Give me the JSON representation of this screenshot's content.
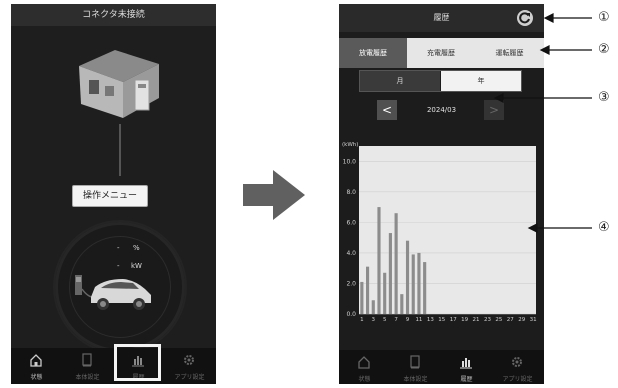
{
  "left_phone": {
    "header_title": "コネクタ未接続",
    "menu_button": "操作メニュー",
    "percent_value": "-",
    "percent_unit": "%",
    "power_value": "-",
    "power_unit": "kW",
    "nav": [
      {
        "label": "状態",
        "icon": "home-icon",
        "active": true
      },
      {
        "label": "本体設定",
        "icon": "device-icon",
        "active": false
      },
      {
        "label": "履歴",
        "icon": "bar-chart-icon",
        "active": false
      },
      {
        "label": "アプリ設定",
        "icon": "gear-icon",
        "active": false
      }
    ]
  },
  "right_phone": {
    "header_title": "履歴",
    "tabs": [
      "放電履歴",
      "充電履歴",
      "運転履歴"
    ],
    "active_tab": 0,
    "period_toggle": {
      "month": "月",
      "year": "年"
    },
    "date": "2024/03",
    "prev_glyph": "<",
    "next_glyph": ">",
    "nav": [
      {
        "label": "状態",
        "icon": "home-icon"
      },
      {
        "label": "本体設定",
        "icon": "device-icon"
      },
      {
        "label": "履歴",
        "icon": "bar-chart-icon",
        "active": true
      },
      {
        "label": "アプリ設定",
        "icon": "gear-icon"
      }
    ]
  },
  "callouts": [
    "①",
    "②",
    "③",
    "④"
  ],
  "colors": {
    "bar": "#8c8c8c",
    "plot_bg": "#e8e8e8",
    "dark": "#1c1c1c"
  },
  "chart_data": {
    "type": "bar",
    "ylabel": "(kWh)",
    "ylim": [
      0,
      11
    ],
    "yticks": [
      "0.0",
      "2.0",
      "4.0",
      "6.0",
      "8.0",
      "10.0"
    ],
    "x": [
      1,
      2,
      3,
      4,
      5,
      6,
      7,
      8,
      9,
      10,
      11,
      12,
      13,
      14,
      15,
      16,
      17,
      18,
      19,
      20,
      21,
      22,
      23,
      24,
      25,
      26,
      27,
      28,
      29,
      30,
      31
    ],
    "xtick_labels": [
      "1",
      "3",
      "5",
      "7",
      "9",
      "11",
      "13",
      "15",
      "17",
      "19",
      "21",
      "23",
      "25",
      "27",
      "29",
      "31"
    ],
    "values": [
      2.1,
      3.1,
      0.9,
      7.0,
      2.7,
      5.3,
      6.6,
      1.3,
      4.8,
      3.9,
      4.0,
      3.4,
      0,
      0,
      0,
      0,
      0,
      0,
      0,
      0,
      0,
      0,
      0,
      0,
      0,
      0,
      0,
      0,
      0,
      0,
      0
    ],
    "grid": true
  }
}
